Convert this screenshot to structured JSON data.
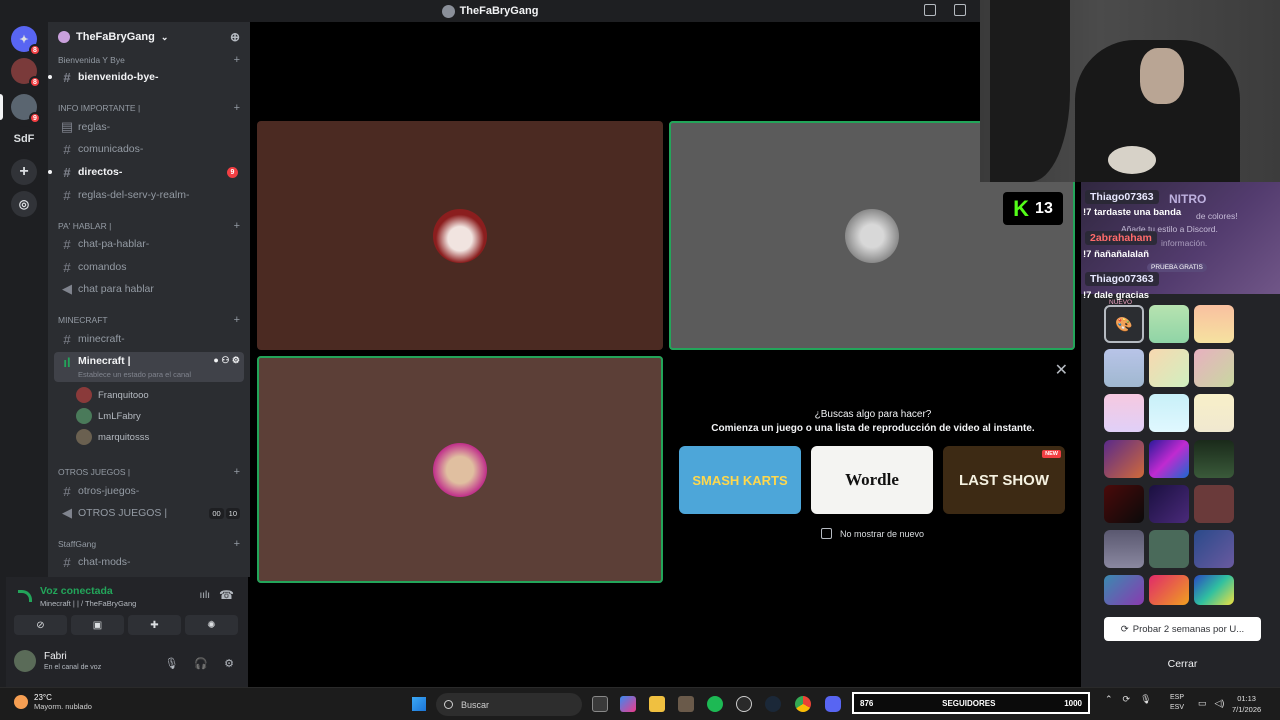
{
  "window": {
    "title": "TheFaBryGang"
  },
  "rail": {
    "dm_badge": "8",
    "server1_badge": "8",
    "server2_badge": "9",
    "sdf_label": "SdF"
  },
  "server": {
    "name": "TheFaBryGang"
  },
  "channels": {
    "cat_bienvenida": "Bienvenida Y Bye",
    "ch_bienvenido": "bienvenido-bye-",
    "cat_info": "INFO IMPORTANTE |",
    "ch_reglas": "reglas-",
    "ch_comunicados": "comunicados-",
    "ch_directos": "directos-",
    "directos_badge": "9",
    "ch_reglas_serv": "reglas-del-serv-y-realm-",
    "cat_pa_hablar": "PA' HABLAR |",
    "ch_chat_pa": "chat-pa-hablar-",
    "ch_comandos": "comandos",
    "ch_chat_voice": "chat para hablar",
    "cat_minecraft": "MINECRAFT",
    "ch_minecraft_text": "minecraft-",
    "ch_minecraft_voice": "Minecraft |",
    "status_placeholder": "Establece un estado para el canal",
    "voice_users": [
      "Franquitooo",
      "LmLFabry",
      "marquitosss"
    ],
    "cat_otros": "OTROS JUEGOS |",
    "ch_otros_text": "otros-juegos-",
    "ch_otros_voice": "OTROS JUEGOS |",
    "otros_count_a": "00",
    "otros_count_b": "10",
    "cat_staff": "StaffGang",
    "ch_chat_mods": "chat-mods-"
  },
  "voice": {
    "status": "Voz conectada",
    "location": "Minecraft | | / TheFaBryGang",
    "user": "Fabri",
    "user_status": "En el canal de voz"
  },
  "activity": {
    "question": "¿Buscas algo para hacer?",
    "subtitle": "Comienza un juego o una lista de reproducción de video al instante.",
    "games": [
      "SMASH KARTS",
      "Wordle",
      "LAST SHOW"
    ],
    "new_badge": "NEW",
    "dont_show": "No mostrar de nuevo"
  },
  "k13": {
    "number": "13"
  },
  "chat": [
    {
      "name": "Thiago07363",
      "color": "#e8e8ff",
      "msg": "!7 tardaste una banda"
    },
    {
      "name": "2abrahaham",
      "color": "#ff6b6b",
      "msg": "!7 ñañañalalañ"
    },
    {
      "name": "Thiago07363",
      "color": "#e8e8ff",
      "msg": "!7 dale gracias"
    }
  ],
  "nitro_panel": {
    "ghost1": "NITRO",
    "ghost2": "de colores!",
    "ghost3": "Añade tu estilo a Discord.",
    "ghost4": "información.",
    "ghost5": "PRUEBA GRATIS",
    "ghost6": "NUEVO",
    "trial": "Probar 2 semanas por U...",
    "close": "Cerrar"
  },
  "taskbar": {
    "temp": "23°C",
    "weather": "Mayorm. nublado",
    "search": "Buscar",
    "followers_current": "876",
    "followers_label": "SEGUIDORES",
    "followers_goal": "1000",
    "lang1": "ESP",
    "lang2": "ESV",
    "time": "01:13",
    "date": "7/1/2026"
  }
}
